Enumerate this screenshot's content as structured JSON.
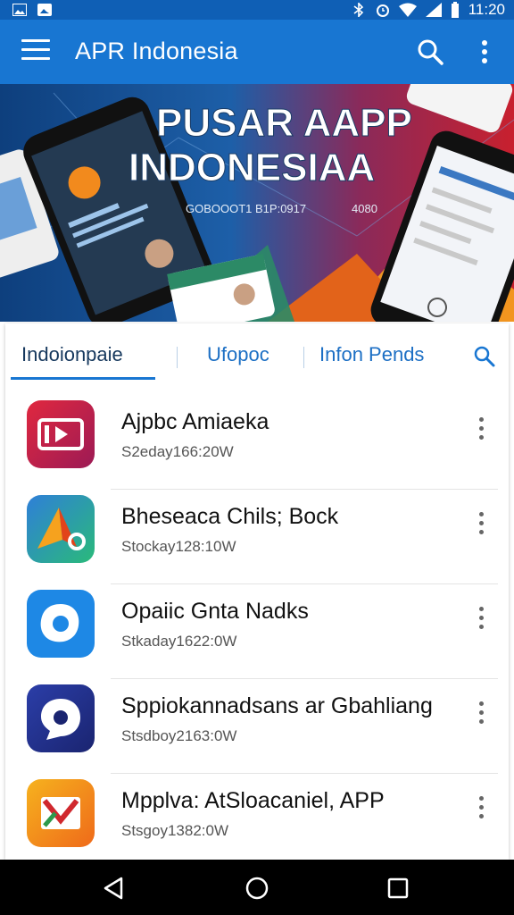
{
  "status_bar": {
    "time": "11:20"
  },
  "app_bar": {
    "title": "APR Indonesia"
  },
  "banner": {
    "headline_line1": "PUSAR AAPP",
    "headline_line2": "INDONESIAA",
    "sub_text": "GOBOOOT1 B1P:0917",
    "sub_text_right": "4080",
    "colors": [
      "#1d5fa8",
      "#c8202e",
      "#f6a21e",
      "#2c8a66"
    ]
  },
  "tabs": [
    {
      "label": "Indoionpaie",
      "active": true
    },
    {
      "label": "Ufopoc",
      "active": false
    },
    {
      "label": "Infon Pends",
      "active": false
    }
  ],
  "apps": [
    {
      "name": "Ajpbc Amiaeka",
      "meta": "S2eday166:20W",
      "icon": "play-media-icon",
      "color": "#c9213d"
    },
    {
      "name": "Bheseaca Chils; Bock",
      "meta": "Stockay128:10W",
      "icon": "kite-arrow-icon",
      "color": "#2a9d6e"
    },
    {
      "name": "Opaiic Gnta Nadks",
      "meta": "Stkaday1622:0W",
      "icon": "ring-blob-icon",
      "color": "#1e88e5"
    },
    {
      "name": "Sppiokannadsans ar Gbahliang",
      "meta": "Stsdboy2163:0W",
      "icon": "chat-bubble-icon",
      "color": "#22338f"
    },
    {
      "name": "Mpplva: AtSloacaniel, APP",
      "meta": "Stsgoy1382:0W",
      "icon": "envelope-m-icon",
      "color": "#f39c12"
    }
  ]
}
